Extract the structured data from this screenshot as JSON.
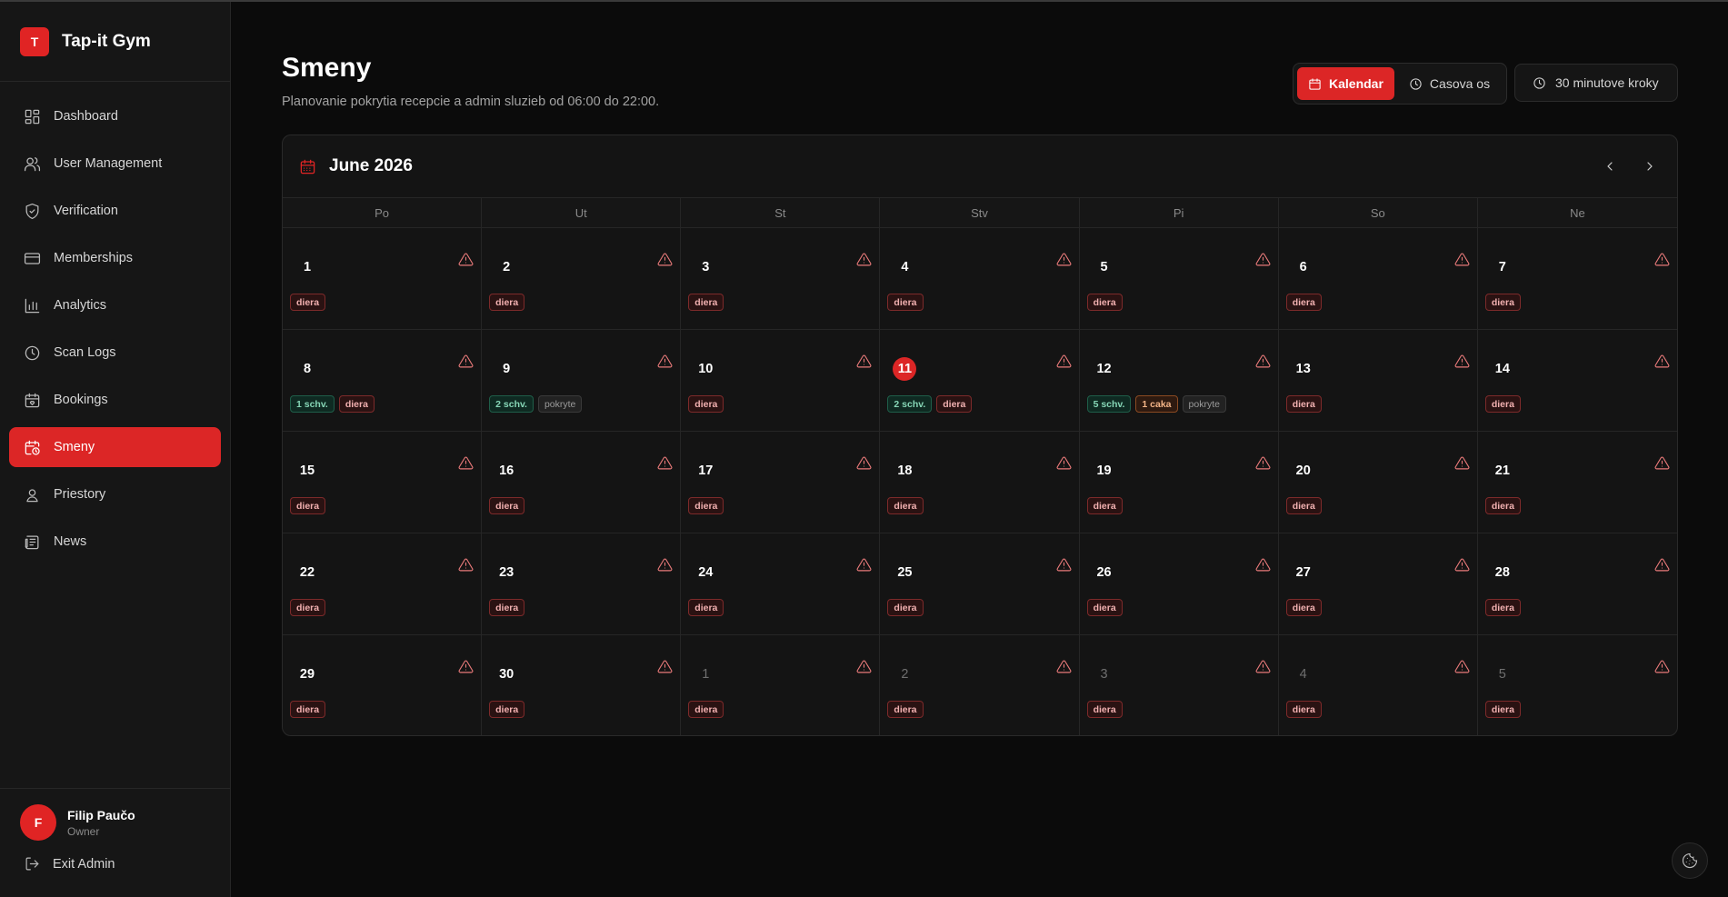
{
  "brand": {
    "logo_letter": "T",
    "name": "Tap-it Gym"
  },
  "sidebar": {
    "items": [
      {
        "label": "Dashboard",
        "icon": "dashboard-icon",
        "active": false
      },
      {
        "label": "User Management",
        "icon": "users-icon",
        "active": false
      },
      {
        "label": "Verification",
        "icon": "shield-check-icon",
        "active": false
      },
      {
        "label": "Memberships",
        "icon": "credit-card-icon",
        "active": false
      },
      {
        "label": "Analytics",
        "icon": "bar-chart-icon",
        "active": false
      },
      {
        "label": "Scan Logs",
        "icon": "clock-icon",
        "active": false
      },
      {
        "label": "Bookings",
        "icon": "calendar-heart-icon",
        "active": false
      },
      {
        "label": "Smeny",
        "icon": "calendar-clock-icon",
        "active": true
      },
      {
        "label": "Priestory",
        "icon": "location-user-icon",
        "active": false
      },
      {
        "label": "News",
        "icon": "newspaper-icon",
        "active": false
      }
    ]
  },
  "user": {
    "initial": "F",
    "name": "Filip Paučo",
    "role": "Owner"
  },
  "exit_label": "Exit Admin",
  "page": {
    "title": "Smeny",
    "subtitle": "Planovanie pokrytia recepcie a admin sluzieb od 06:00 do 22:00."
  },
  "view_toggle": {
    "calendar": "Kalendar",
    "timeline": "Casova os",
    "active": "calendar"
  },
  "step_label": "30 minutove kroky",
  "calendar": {
    "month_label": "June 2026",
    "weekdays": [
      "Po",
      "Ut",
      "St",
      "Stv",
      "Pi",
      "So",
      "Ne"
    ],
    "today": 11,
    "days": [
      {
        "day": "1",
        "badges": [
          {
            "text": "diera",
            "type": "diera"
          }
        ]
      },
      {
        "day": "2",
        "badges": [
          {
            "text": "diera",
            "type": "diera"
          }
        ]
      },
      {
        "day": "3",
        "badges": [
          {
            "text": "diera",
            "type": "diera"
          }
        ]
      },
      {
        "day": "4",
        "badges": [
          {
            "text": "diera",
            "type": "diera"
          }
        ]
      },
      {
        "day": "5",
        "badges": [
          {
            "text": "diera",
            "type": "diera"
          }
        ]
      },
      {
        "day": "6",
        "badges": [
          {
            "text": "diera",
            "type": "diera"
          }
        ]
      },
      {
        "day": "7",
        "badges": [
          {
            "text": "diera",
            "type": "diera"
          }
        ]
      },
      {
        "day": "8",
        "badges": [
          {
            "text": "1 schv.",
            "type": "schv"
          },
          {
            "text": "diera",
            "type": "diera"
          }
        ]
      },
      {
        "day": "9",
        "badges": [
          {
            "text": "2 schv.",
            "type": "schv"
          },
          {
            "text": "pokryte",
            "type": "pokryte"
          }
        ],
        "no_warn": true
      },
      {
        "day": "10",
        "badges": [
          {
            "text": "diera",
            "type": "diera"
          }
        ]
      },
      {
        "day": "11",
        "today": true,
        "badges": [
          {
            "text": "2 schv.",
            "type": "schv"
          },
          {
            "text": "diera",
            "type": "diera"
          }
        ]
      },
      {
        "day": "12",
        "badges": [
          {
            "text": "5 schv.",
            "type": "schv"
          },
          {
            "text": "1 caka",
            "type": "caka"
          },
          {
            "text": "pokryte",
            "type": "pokryte"
          }
        ],
        "no_warn": true
      },
      {
        "day": "13",
        "badges": [
          {
            "text": "diera",
            "type": "diera"
          }
        ]
      },
      {
        "day": "14",
        "badges": [
          {
            "text": "diera",
            "type": "diera"
          }
        ]
      },
      {
        "day": "15",
        "badges": [
          {
            "text": "diera",
            "type": "diera"
          }
        ]
      },
      {
        "day": "16",
        "badges": [
          {
            "text": "diera",
            "type": "diera"
          }
        ]
      },
      {
        "day": "17",
        "badges": [
          {
            "text": "diera",
            "type": "diera"
          }
        ]
      },
      {
        "day": "18",
        "badges": [
          {
            "text": "diera",
            "type": "diera"
          }
        ]
      },
      {
        "day": "19",
        "badges": [
          {
            "text": "diera",
            "type": "diera"
          }
        ]
      },
      {
        "day": "20",
        "badges": [
          {
            "text": "diera",
            "type": "diera"
          }
        ]
      },
      {
        "day": "21",
        "badges": [
          {
            "text": "diera",
            "type": "diera"
          }
        ]
      },
      {
        "day": "22",
        "badges": [
          {
            "text": "diera",
            "type": "diera"
          }
        ]
      },
      {
        "day": "23",
        "badges": [
          {
            "text": "diera",
            "type": "diera"
          }
        ]
      },
      {
        "day": "24",
        "badges": [
          {
            "text": "diera",
            "type": "diera"
          }
        ]
      },
      {
        "day": "25",
        "badges": [
          {
            "text": "diera",
            "type": "diera"
          }
        ]
      },
      {
        "day": "26",
        "badges": [
          {
            "text": "diera",
            "type": "diera"
          }
        ]
      },
      {
        "day": "27",
        "badges": [
          {
            "text": "diera",
            "type": "diera"
          }
        ]
      },
      {
        "day": "28",
        "badges": [
          {
            "text": "diera",
            "type": "diera"
          }
        ]
      },
      {
        "day": "29",
        "badges": [
          {
            "text": "diera",
            "type": "diera"
          }
        ]
      },
      {
        "day": "30",
        "badges": [
          {
            "text": "diera",
            "type": "diera"
          }
        ]
      },
      {
        "day": "1",
        "muted": true,
        "badges": [
          {
            "text": "diera",
            "type": "diera"
          }
        ]
      },
      {
        "day": "2",
        "muted": true,
        "badges": [
          {
            "text": "diera",
            "type": "diera"
          }
        ]
      },
      {
        "day": "3",
        "muted": true,
        "badges": [
          {
            "text": "diera",
            "type": "diera"
          }
        ]
      },
      {
        "day": "4",
        "muted": true,
        "badges": [
          {
            "text": "diera",
            "type": "diera"
          }
        ]
      },
      {
        "day": "5",
        "muted": true,
        "badges": [
          {
            "text": "diera",
            "type": "diera"
          }
        ]
      }
    ]
  },
  "colors": {
    "accent": "#dc2626",
    "background": "#0b0b0b",
    "sidebar": "#161616",
    "panel": "#141414"
  }
}
